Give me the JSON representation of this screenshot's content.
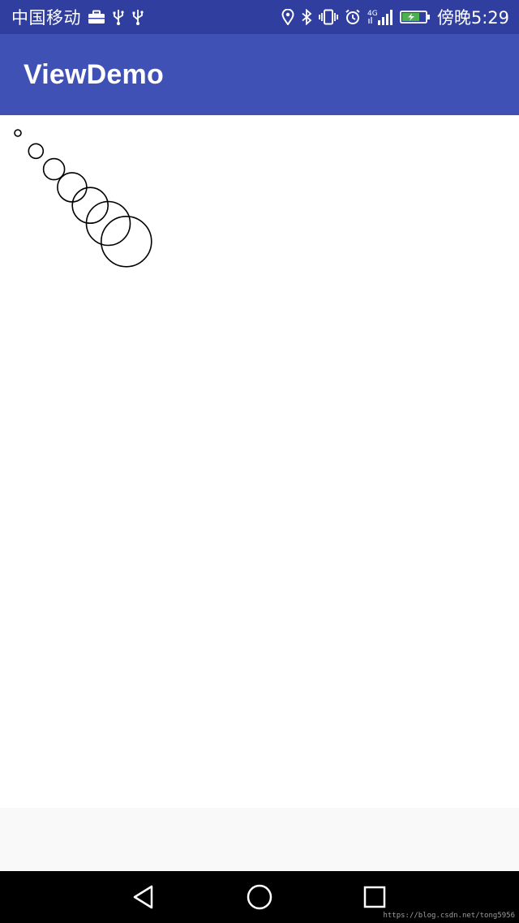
{
  "status_bar": {
    "carrier": "中国移动",
    "network": "4G",
    "time": "傍晚5:29",
    "background_color": "#303f9f",
    "icons": [
      "briefcase-icon",
      "usb-icon",
      "usb-icon",
      "location-icon",
      "bluetooth-icon",
      "vibrate-icon",
      "alarm-icon",
      "signal-icon",
      "battery-charging-icon"
    ]
  },
  "app_bar": {
    "title": "ViewDemo",
    "background_color": "#3f51b5"
  },
  "content": {
    "circles": [
      {
        "radius": 4
      },
      {
        "radius": 9
      },
      {
        "radius": 13
      },
      {
        "radius": 18
      },
      {
        "radius": 22
      },
      {
        "radius": 27
      },
      {
        "radius": 31
      }
    ],
    "stroke_color": "#000000"
  },
  "navigation_bar": {
    "buttons": [
      "back-button",
      "home-button",
      "recents-button"
    ]
  },
  "watermark": "https://blog.csdn.net/tong5956"
}
